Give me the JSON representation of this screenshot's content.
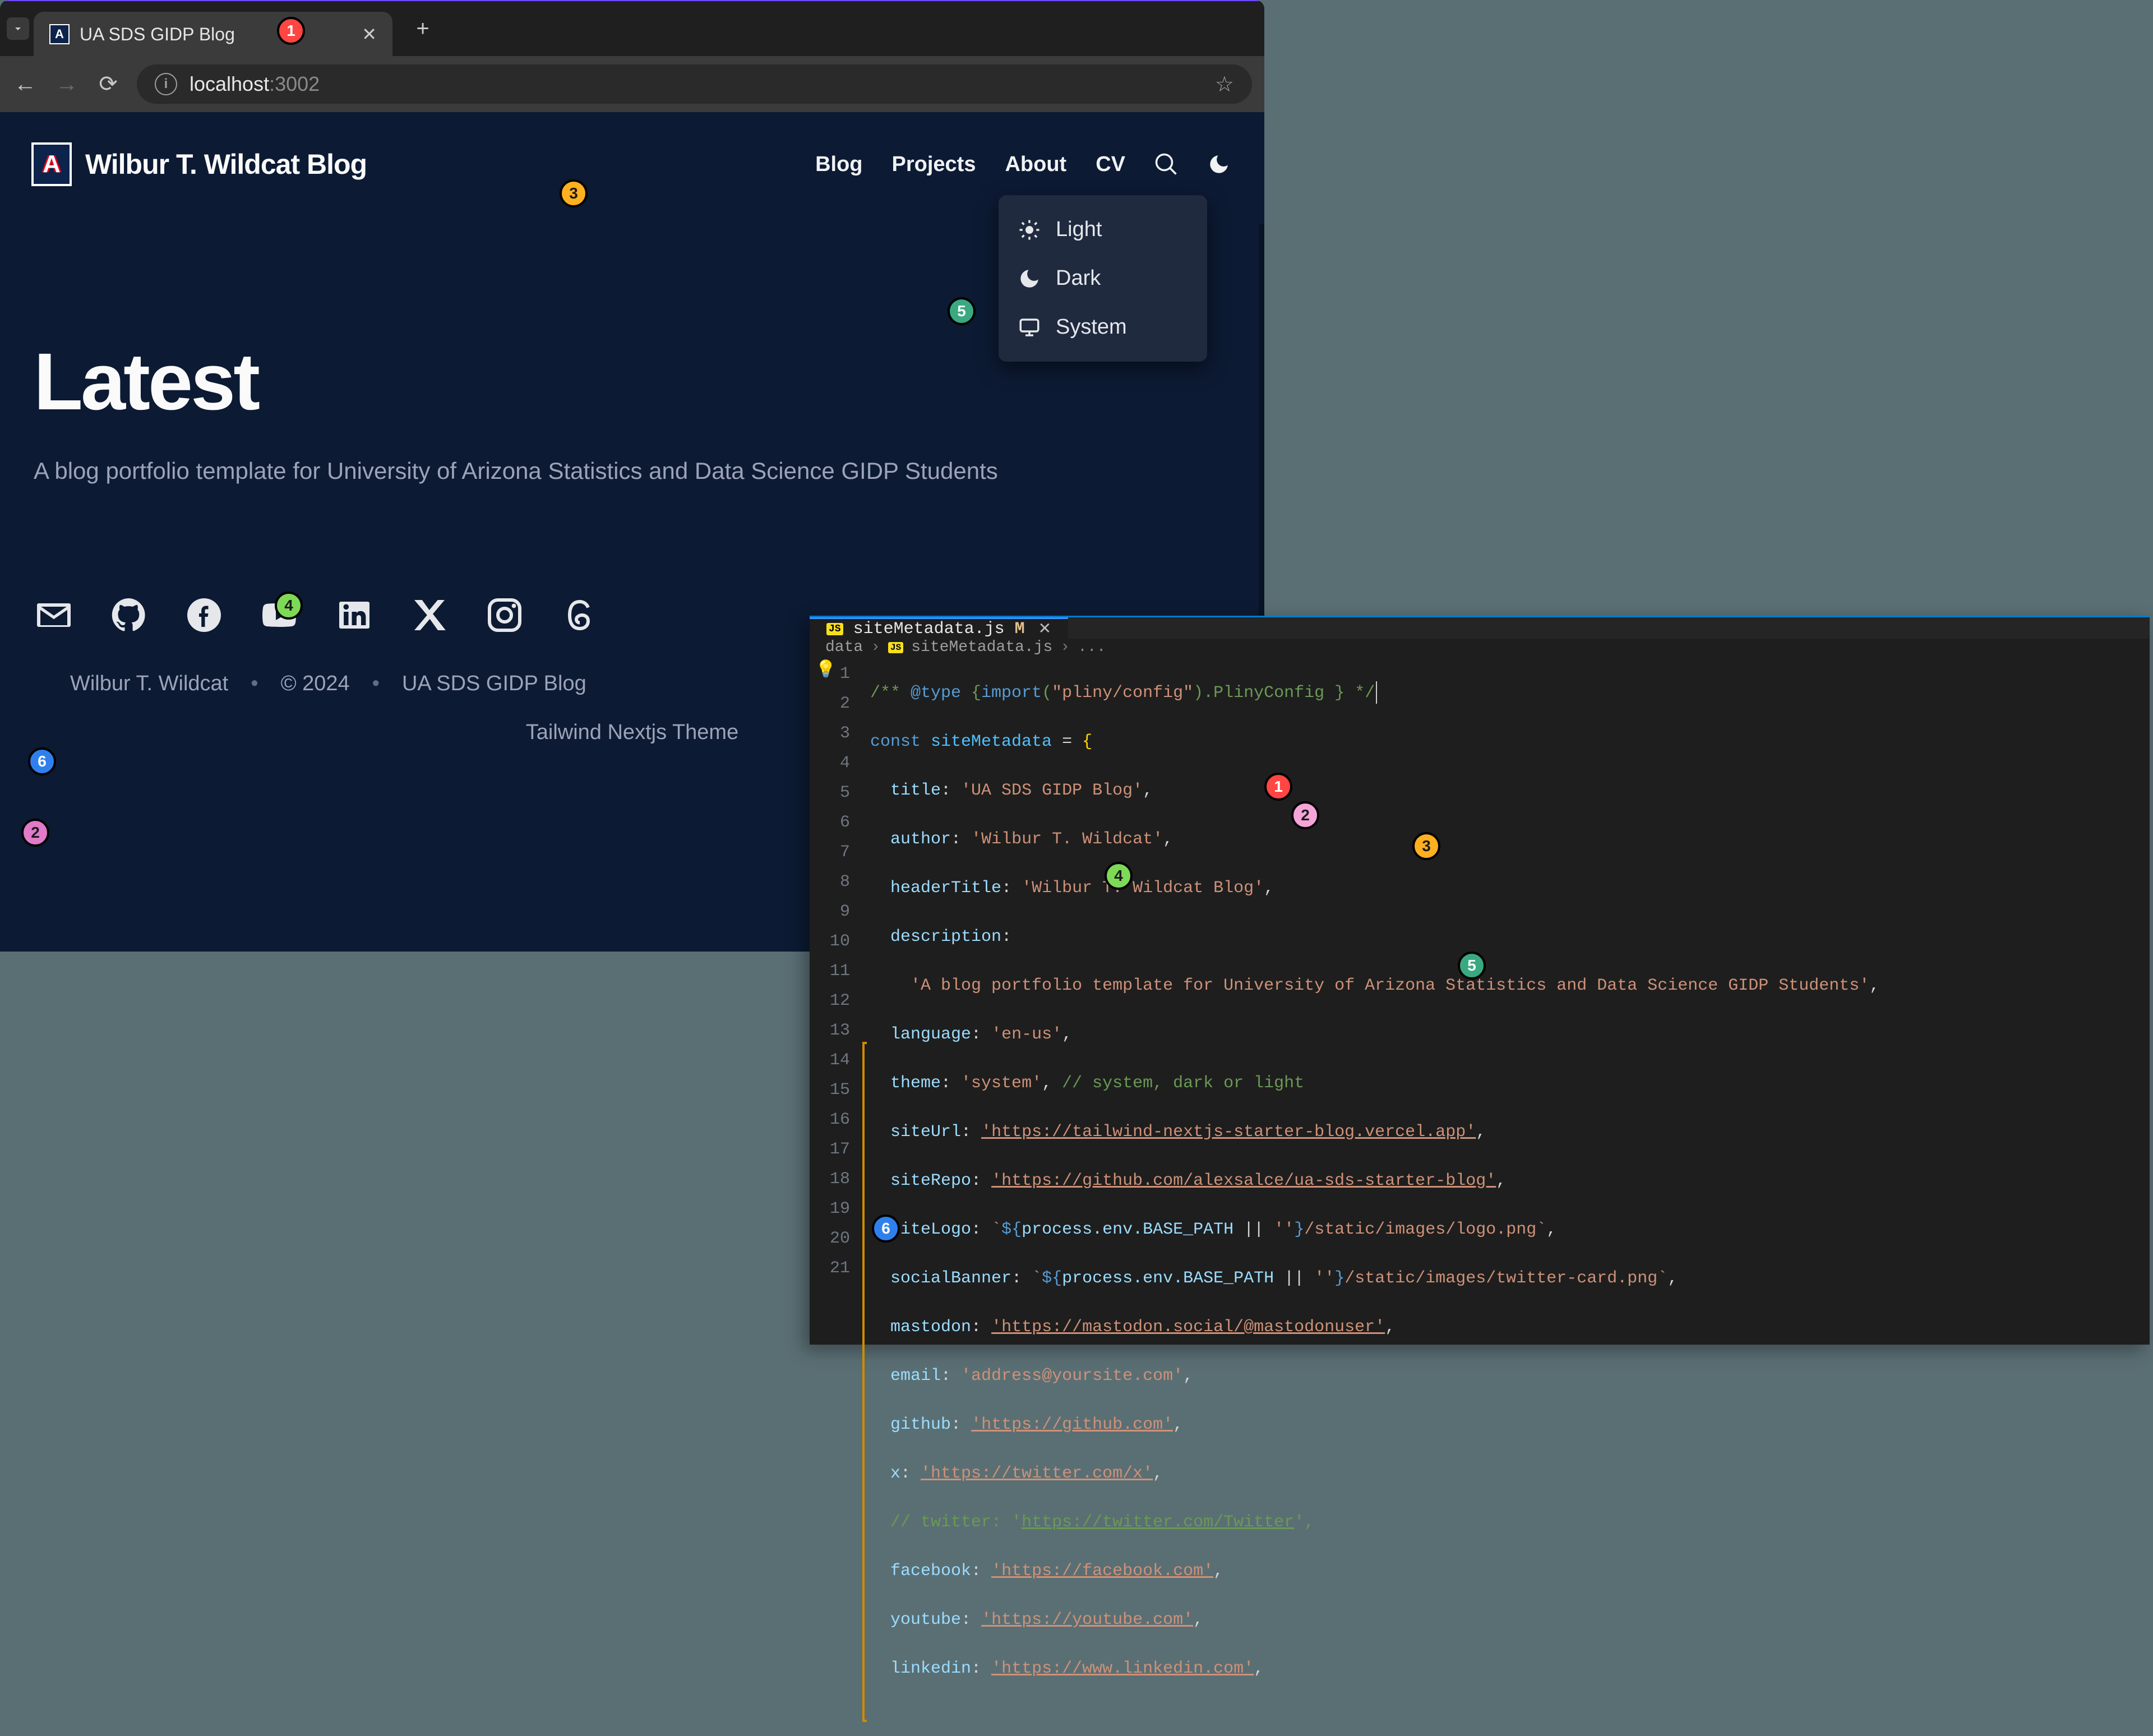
{
  "browser": {
    "tab_title": "UA SDS GIDP Blog",
    "favicon_letter": "A",
    "url_host": "localhost",
    "url_port": ":3002"
  },
  "site": {
    "header_title": "Wilbur T. Wildcat Blog",
    "nav_blog": "Blog",
    "nav_projects": "Projects",
    "nav_about": "About",
    "nav_cv": "CV"
  },
  "theme_menu": {
    "light": "Light",
    "dark": "Dark",
    "system": "System"
  },
  "hero": {
    "heading": "Latest",
    "description": "A blog portfolio template for University of Arizona Statistics and Data Science GIDP Students"
  },
  "footer": {
    "author": "Wilbur T. Wildcat",
    "copyright": "© 2024",
    "site_name": "UA SDS GIDP Blog",
    "theme_credit": "Tailwind Nextjs Theme",
    "sep": "•"
  },
  "editor": {
    "tab_file": "siteMetadata.js",
    "tab_modified": "M",
    "crumb_dir": "data",
    "crumb_file": "siteMetadata.js",
    "crumb_ellipsis": "...",
    "line_numbers": [
      "1",
      "2",
      "3",
      "4",
      "5",
      "6",
      "7",
      "8",
      "9",
      "10",
      "11",
      "12",
      "13",
      "14",
      "15",
      "16",
      "17",
      "18",
      "19",
      "20",
      "21"
    ],
    "code": {
      "l1_a": "/** ",
      "l1_b": "@type",
      "l1_c": " {",
      "l1_d": "import",
      "l1_e": "(",
      "l1_f": "\"pliny/config\"",
      "l1_g": ").PlinyConfig } */",
      "l2_a": "const",
      "l2_b": " siteMetadata ",
      "l2_c": "= ",
      "l2_d": "{",
      "l3_k": "title",
      "l3_v": "'UA SDS GIDP Blog'",
      "l4_k": "author",
      "l4_v": "'Wilbur T. Wildcat'",
      "l5_k": "headerTitle",
      "l5_v": "'Wilbur T. Wildcat Blog'",
      "l6_k": "description",
      "l7_v": "'A blog portfolio template for University of Arizona Statistics and Data Science GIDP Students'",
      "l8_k": "language",
      "l8_v": "'en-us'",
      "l9_k": "theme",
      "l9_v": "'system'",
      "l9_c": " // system, dark or light",
      "l10_k": "siteUrl",
      "l10_v": "'https://tailwind-nextjs-starter-blog.vercel.app'",
      "l11_k": "siteRepo",
      "l11_v": "'https://github.com/alexsalce/ua-sds-starter-blog'",
      "l12_k": "siteLogo",
      "l12_a": "`",
      "l12_b": "${",
      "l12_c": "process.env.BASE_PATH",
      "l12_d": " || ",
      "l12_e": "''",
      "l12_f": "}",
      "l12_g": "/static/images/logo.png",
      "l12_h": "`",
      "l13_k": "socialBanner",
      "l13_a": "`",
      "l13_b": "${",
      "l13_c": "process.env.BASE_PATH",
      "l13_d": " || ",
      "l13_e": "''",
      "l13_f": "}",
      "l13_g": "/static/images/twitter-card.png",
      "l13_h": "`",
      "l14_k": "mastodon",
      "l14_v": "'https://mastodon.social/@mastodonuser'",
      "l15_k": "email",
      "l15_v": "'address@yoursite.com'",
      "l16_k": "github",
      "l16_v": "'https://github.com'",
      "l17_k": "x",
      "l17_v": "'https://twitter.com/x'",
      "l18_c": "// twitter: '",
      "l18_u": "https://twitter.com/Twitter",
      "l18_c2": "',",
      "l19_k": "facebook",
      "l19_v": "'https://facebook.com'",
      "l20_k": "youtube",
      "l20_v": "'https://youtube.com'",
      "l21_k": "linkedin",
      "l21_v": "'https://www.linkedin.com'"
    }
  },
  "annotations": {
    "b1": "1",
    "b2": "2",
    "b3": "3",
    "b4": "4",
    "b5": "5",
    "b6": "6"
  }
}
